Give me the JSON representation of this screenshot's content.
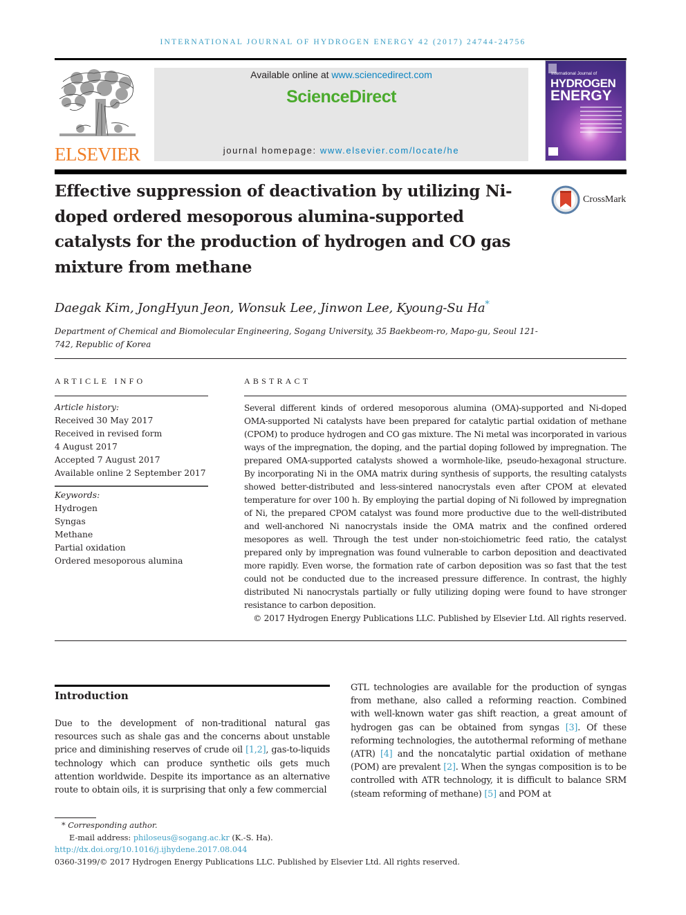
{
  "running_head": "INTERNATIONAL JOURNAL OF HYDROGEN ENERGY 42 (2017) 24744-24756",
  "publisher": {
    "logo_name": "ELSEVIER",
    "logo_color": "#f07e26"
  },
  "sciencedirect": {
    "available_prefix": "Available online at ",
    "available_link": "www.sciencedirect.com",
    "brand": "ScienceDirect",
    "brand_color": "#4aaa2c",
    "homepage_prefix": "journal homepage: ",
    "homepage_link": "www.elsevier.com/locate/he",
    "link_color": "#0a84c1"
  },
  "journal_cover": {
    "line1": "International Journal of",
    "line2": "HYDROGEN",
    "line3": "ENERGY"
  },
  "article": {
    "title": "Effective suppression of deactivation by utilizing Ni-doped ordered mesoporous alumina-supported catalysts for the production of hydrogen and CO gas mixture from methane",
    "crossmark_label": "CrossMark",
    "authors": "Daegak Kim, JongHyun Jeon, Wonsuk Lee, Jinwon Lee, Kyoung-Su Ha",
    "corresponding_marker": "*",
    "affiliation": "Department of Chemical and Biomolecular Engineering, Sogang University, 35 Baekbeom-ro, Mapo-gu, Seoul 121-742, Republic of Korea"
  },
  "article_info": {
    "heading": "ARTICLE INFO",
    "history_label": "Article history:",
    "history": [
      "Received 30 May 2017",
      "Received in revised form",
      "4 August 2017",
      "Accepted 7 August 2017",
      "Available online 2 September 2017"
    ],
    "keywords_label": "Keywords:",
    "keywords": [
      "Hydrogen",
      "Syngas",
      "Methane",
      "Partial oxidation",
      "Ordered mesoporous alumina"
    ]
  },
  "abstract": {
    "heading": "ABSTRACT",
    "text": "Several different kinds of ordered mesoporous alumina (OMA)-supported and Ni-doped OMA-supported Ni catalysts have been prepared for catalytic partial oxidation of methane (CPOM) to produce hydrogen and CO gas mixture. The Ni metal was incorporated in various ways of the impregnation, the doping, and the partial doping followed by impregnation. The prepared OMA-supported catalysts showed a wormhole-like, pseudo-hexagonal structure. By incorporating Ni in the OMA matrix during synthesis of supports, the resulting catalysts showed better-distributed and less-sintered nanocrystals even after CPOM at elevated temperature for over 100 h. By employing the partial doping of Ni followed by impregnation of Ni, the prepared CPOM catalyst was found more productive due to the well-distributed and well-anchored Ni nanocrystals inside the OMA matrix and the confined ordered mesopores as well. Through the test under non-stoichiometric feed ratio, the catalyst prepared only by impregnation was found vulnerable to carbon deposition and deactivated more rapidly. Even worse, the formation rate of carbon deposition was so fast that the test could not be conducted due to the increased pressure difference. In contrast, the highly distributed Ni nanocrystals partially or fully utilizing doping were found to have stronger resistance to carbon deposition.",
    "copyright": "© 2017 Hydrogen Energy Publications LLC. Published by Elsevier Ltd. All rights reserved."
  },
  "introduction": {
    "heading": "Introduction",
    "left_col": [
      {
        "t": "Due to the development of non-traditional natural gas resources such as shale gas and the concerns about unstable price and diminishing reserves of crude oil "
      },
      {
        "ref": "[1,2]"
      },
      {
        "t": ", gas-to-liquids technology which can produce synthetic oils gets much attention worldwide. Despite its importance as an alternative route to obtain oils, it is surprising that only a few commercial"
      }
    ],
    "right_col": [
      {
        "t": "GTL technologies are available for the production of syngas from methane, also called a reforming reaction. Combined with well-known water gas shift reaction, a great amount of hydrogen gas can be obtained from syngas "
      },
      {
        "ref": "[3]"
      },
      {
        "t": ". Of these reforming technologies, the autothermal reforming of methane (ATR) "
      },
      {
        "ref": "[4]"
      },
      {
        "t": " and the noncatalytic partial oxidation of methane (POM) are prevalent "
      },
      {
        "ref": "[2]"
      },
      {
        "t": ". When the syngas composition is to be controlled with ATR technology, it is difficult to balance SRM (steam reforming of methane) "
      },
      {
        "ref": "[5]"
      },
      {
        "t": " and POM at"
      }
    ]
  },
  "footnotes": {
    "corresponding": "* Corresponding author.",
    "email_label": "E-mail address: ",
    "email": "philoseus@sogang.ac.kr",
    "email_suffix": " (K.-S. Ha).",
    "doi": "http://dx.doi.org/10.1016/j.ijhydene.2017.08.044",
    "issn_copyright": "0360-3199/© 2017 Hydrogen Energy Publications LLC. Published by Elsevier Ltd. All rights reserved."
  }
}
